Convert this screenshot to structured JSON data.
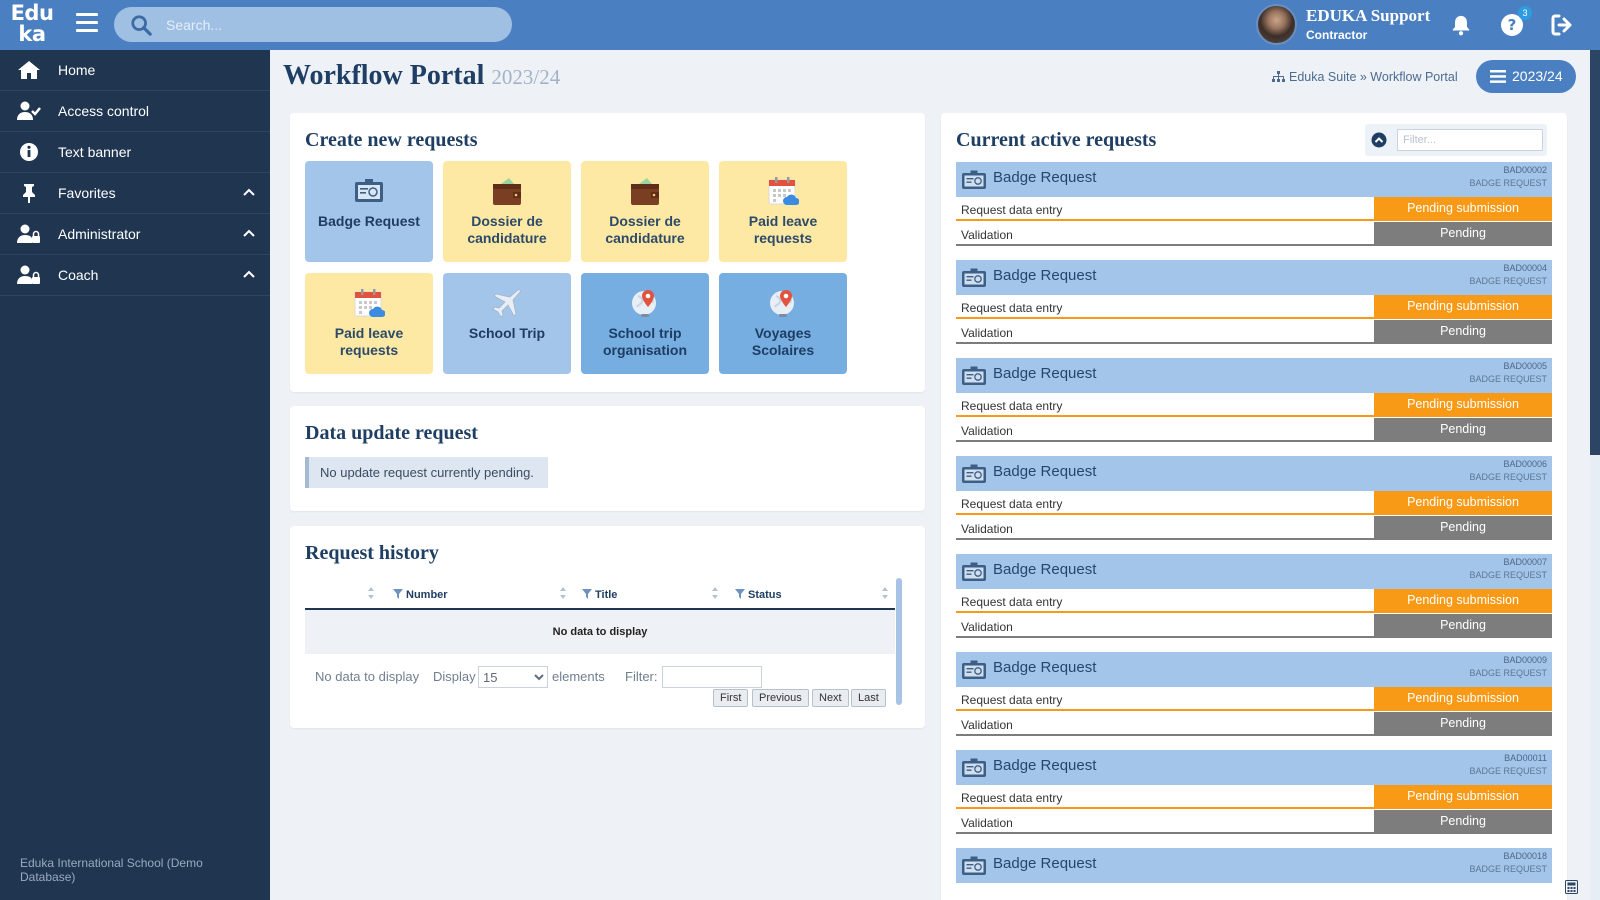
{
  "app": {
    "logo_line1": "Edu",
    "logo_line2": "ka",
    "search_placeholder": "Search..."
  },
  "user": {
    "name": "EDUKA Support",
    "role": "Contractor",
    "help_badge": "3"
  },
  "sidebar": {
    "items": [
      {
        "label": "Home",
        "icon": "home-icon"
      },
      {
        "label": "Access control",
        "icon": "user-check-icon"
      },
      {
        "label": "Text banner",
        "icon": "info-circle-icon"
      },
      {
        "label": "Favorites",
        "icon": "pin-icon"
      },
      {
        "label": "Administrator",
        "icon": "user-lock-icon"
      },
      {
        "label": "Coach",
        "icon": "user-lock-icon"
      }
    ],
    "footer": "Eduka International School (Demo Database)"
  },
  "page": {
    "title": "Workflow Portal",
    "year": "2023/24",
    "breadcrumb": "Eduka Suite » Workflow Portal",
    "year_button": "2023/24"
  },
  "create": {
    "title": "Create new requests",
    "tiles": [
      {
        "line1": "Badge Request",
        "line2": "",
        "icon": "badge-icon",
        "color": "#a4c5ea"
      },
      {
        "line1": "Dossier de",
        "line2": "candidature",
        "icon": "wallet-icon",
        "color": "#fde9a3"
      },
      {
        "line1": "Dossier de",
        "line2": "candidature",
        "icon": "wallet-icon",
        "color": "#fde9a3"
      },
      {
        "line1": "Paid leave",
        "line2": "requests",
        "icon": "calendar-icon",
        "color": "#fde9a3"
      },
      {
        "line1": "Paid leave",
        "line2": "requests",
        "icon": "calendar-icon",
        "color": "#fde9a3"
      },
      {
        "line1": "School Trip",
        "line2": "",
        "icon": "airplane-icon",
        "color": "#a4c5ea"
      },
      {
        "line1": "School trip",
        "line2": "organisation",
        "icon": "globe-pin-icon",
        "color": "#77aee2"
      },
      {
        "line1": "Voyages",
        "line2": "Scolaires",
        "icon": "globe-pin-icon",
        "color": "#77aee2"
      }
    ]
  },
  "update": {
    "title": "Data update request",
    "notice": "No update request currently pending."
  },
  "history": {
    "title": "Request history",
    "columns": [
      "Number",
      "Title",
      "Status"
    ],
    "empty": "No data to display",
    "footer_nodata": "No data to display",
    "display_label": "Display",
    "page_size": "15",
    "elements_label": "elements",
    "filter_label": "Filter:",
    "pager": [
      "First",
      "Previous",
      "Next",
      "Last"
    ]
  },
  "active": {
    "title": "Current active requests",
    "filter_placeholder": "Filter...",
    "requests": [
      {
        "title": "Badge Request",
        "id": "BAD00002",
        "type": "BADGE REQUEST",
        "step1": "Request data entry",
        "status1": "Pending submission",
        "step2": "Validation",
        "status2": "Pending"
      },
      {
        "title": "Badge Request",
        "id": "BAD00004",
        "type": "BADGE REQUEST",
        "step1": "Request data entry",
        "status1": "Pending submission",
        "step2": "Validation",
        "status2": "Pending"
      },
      {
        "title": "Badge Request",
        "id": "BAD00005",
        "type": "BADGE REQUEST",
        "step1": "Request data entry",
        "status1": "Pending submission",
        "step2": "Validation",
        "status2": "Pending"
      },
      {
        "title": "Badge Request",
        "id": "BAD00006",
        "type": "BADGE REQUEST",
        "step1": "Request data entry",
        "status1": "Pending submission",
        "step2": "Validation",
        "status2": "Pending"
      },
      {
        "title": "Badge Request",
        "id": "BAD00007",
        "type": "BADGE REQUEST",
        "step1": "Request data entry",
        "status1": "Pending submission",
        "step2": "Validation",
        "status2": "Pending"
      },
      {
        "title": "Badge Request",
        "id": "BAD00009",
        "type": "BADGE REQUEST",
        "step1": "Request data entry",
        "status1": "Pending submission",
        "step2": "Validation",
        "status2": "Pending"
      },
      {
        "title": "Badge Request",
        "id": "BAD00011",
        "type": "BADGE REQUEST",
        "step1": "Request data entry",
        "status1": "Pending submission",
        "step2": "Validation",
        "status2": "Pending"
      },
      {
        "title": "Badge Request",
        "id": "BAD00018",
        "type": "BADGE REQUEST",
        "step1": "",
        "status1": "",
        "step2": "",
        "status2": ""
      }
    ]
  },
  "colors": {
    "topbar": "#4a7fc1",
    "sidebar": "#1f3550",
    "pending_submission": "#f99a17",
    "pending": "#7d7d7d"
  }
}
